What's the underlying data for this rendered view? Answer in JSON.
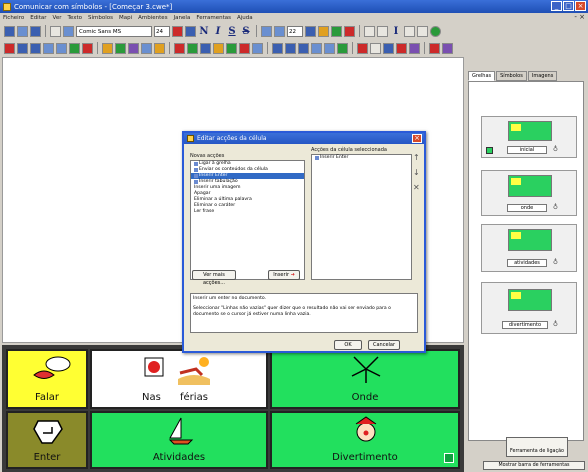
{
  "window": {
    "title": "Comunicar com símbolos - [Começar 3.cwe*]"
  },
  "menu": [
    "Ficheiro",
    "Editar",
    "Ver",
    "Texto",
    "Símbolos",
    "Mapi",
    "Ambientes",
    "Janela",
    "Ferramentas",
    "Ajuda"
  ],
  "toolbar": {
    "font": "Comic Sans MS",
    "size": "24",
    "size2": "22"
  },
  "dialog": {
    "title": "Editar acções da célula",
    "novas_label": "Novas acções",
    "novas_items": [
      "Ligar à grelha",
      "Enviar os conteúdos da célula",
      "Inserir Enter",
      "Inserir tabulação",
      "Inserir uma imagem",
      "Apagar",
      "Eliminar a última palavra",
      "Eliminar o caráter",
      "Ler frase"
    ],
    "selected_index": 2,
    "acoes_label": "Acções da célula seleccionada",
    "acoes_items": [
      "Inserir Enter"
    ],
    "ver_mais": "Ver mais acções...",
    "inserir": "Inserir",
    "description_line1": "Inserir um enter no documento.",
    "description_line2": "Seleccionar \"Linhas não vazias\" quer dizer que o resultado não vai ser enviado para o documento se o cursor já estiver numa linha vazia.",
    "ok": "OK",
    "cancel": "Cancelar"
  },
  "cells": {
    "falar": "Falar",
    "nas": "Nas",
    "ferias": "férias",
    "onde": "Onde",
    "enter": "Enter",
    "atividades": "Atividades",
    "divertimento": "Divertimento"
  },
  "right_panel": {
    "tabs": [
      "Grelhas",
      "Símbolos",
      "Imagens"
    ],
    "grids": [
      "inicial",
      "onde",
      "atividades",
      "divertimento"
    ],
    "ligacao": "Ferramenta de ligação",
    "mostrar": "Mostrar barra de ferramentas"
  },
  "colors": {
    "title_blue": "#1f4fb5",
    "cell_green": "#22e05e",
    "cell_yellow": "#ffff33",
    "selection": "#316ac5"
  }
}
